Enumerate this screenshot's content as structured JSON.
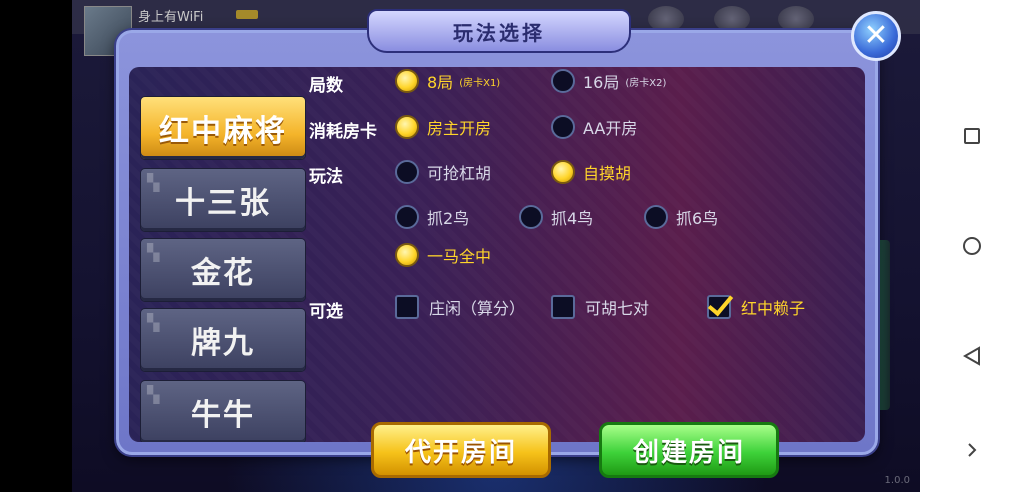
{
  "topbar": {
    "user_name": "身上有WiFi",
    "version": "1.0.0"
  },
  "dialog": {
    "title": "玩法选择",
    "tabs": [
      {
        "label": "红中麻将",
        "active": true
      },
      {
        "label": "十三张",
        "active": false
      },
      {
        "label": "金花",
        "active": false
      },
      {
        "label": "牌九",
        "active": false
      },
      {
        "label": "牛牛",
        "active": false
      }
    ],
    "rounds": {
      "label": "局数",
      "options": [
        {
          "label": "8局",
          "sub": "(房卡X1)",
          "selected": true
        },
        {
          "label": "16局",
          "sub": "(房卡X2)",
          "selected": false
        }
      ]
    },
    "card_cost": {
      "label": "消耗房卡",
      "options": [
        {
          "label": "房主开房",
          "selected": true
        },
        {
          "label": "AA开房",
          "selected": false
        }
      ]
    },
    "play": {
      "label": "玩法",
      "options": [
        {
          "label": "可抢杠胡",
          "selected": false
        },
        {
          "label": "自摸胡",
          "selected": true
        }
      ]
    },
    "birds": {
      "options": [
        {
          "label": "抓2鸟",
          "selected": false
        },
        {
          "label": "抓4鸟",
          "selected": false
        },
        {
          "label": "抓6鸟",
          "selected": false
        },
        {
          "label": "一马全中",
          "selected": true
        }
      ]
    },
    "optional": {
      "label": "可选",
      "options": [
        {
          "label": "庄闲（算分）",
          "checked": false
        },
        {
          "label": "可胡七对",
          "checked": false
        },
        {
          "label": "红中赖子",
          "checked": true
        }
      ]
    },
    "buttons": {
      "proxy_open": "代开房间",
      "create": "创建房间"
    }
  }
}
